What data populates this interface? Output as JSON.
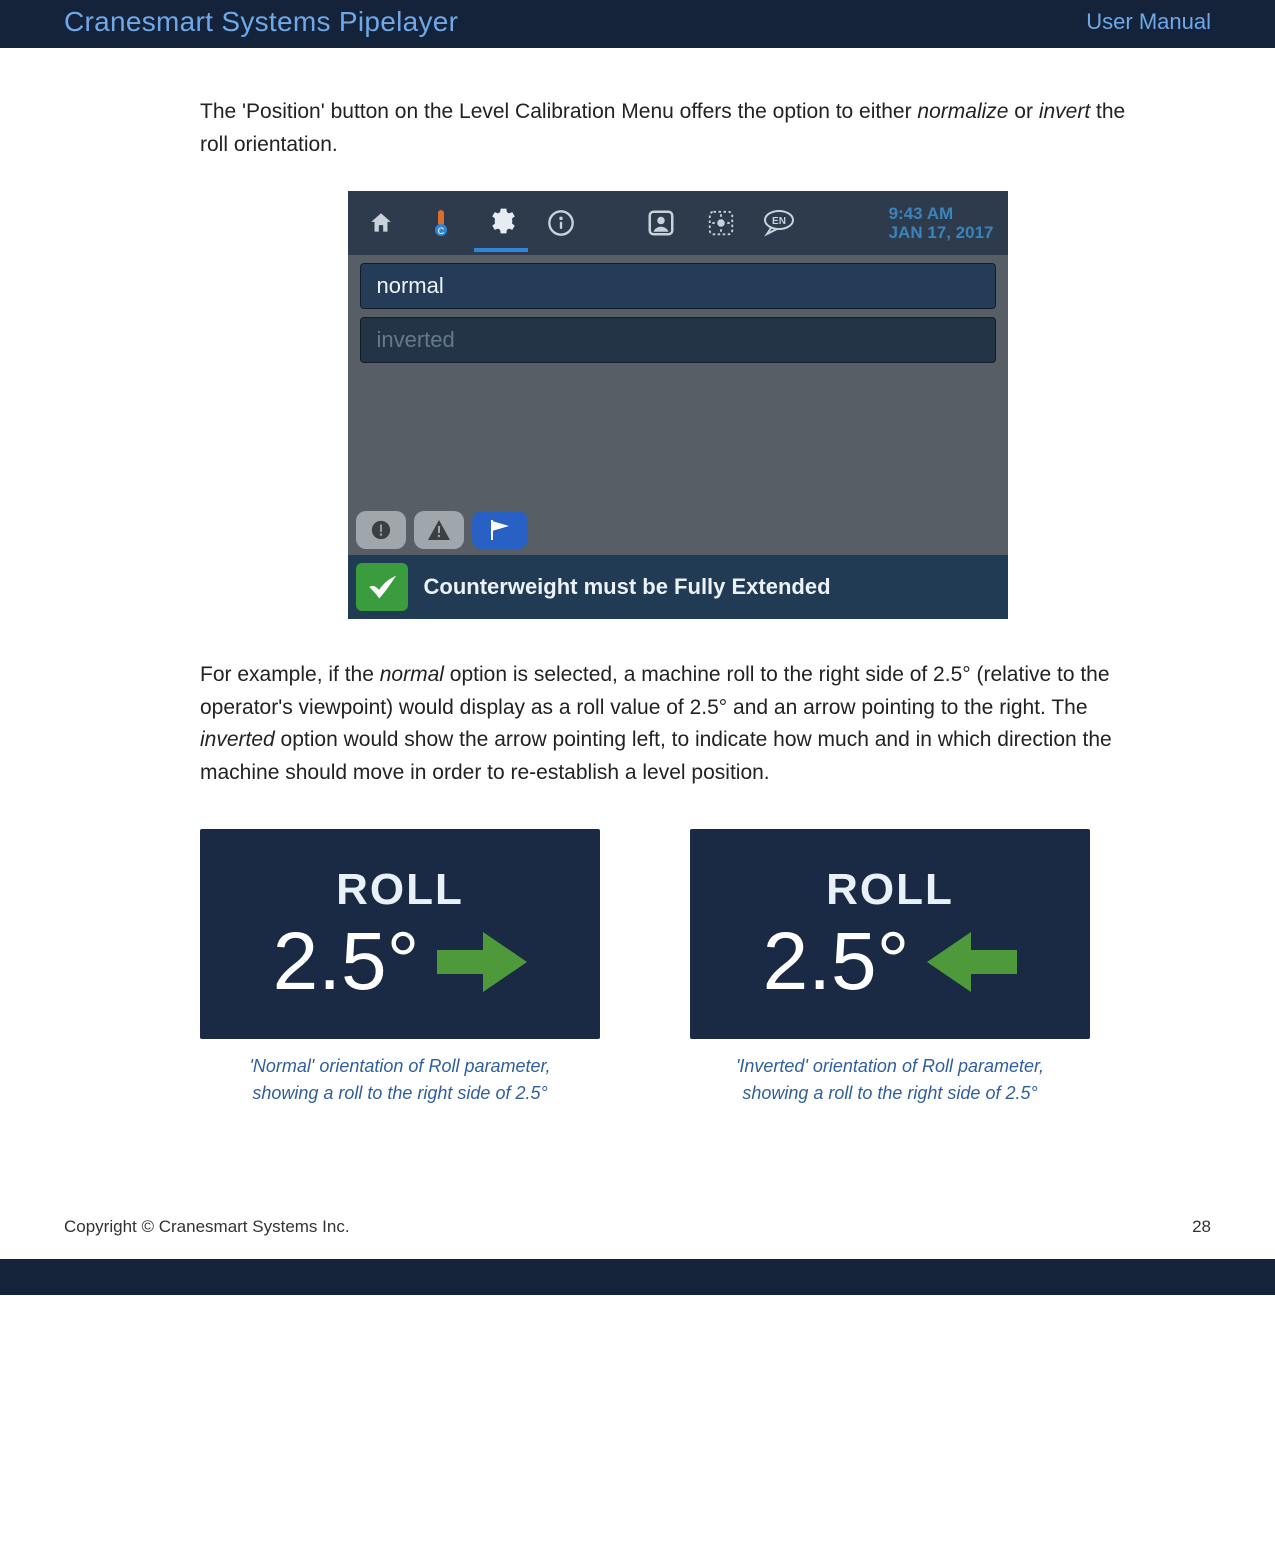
{
  "header": {
    "title": "Cranesmart Systems Pipelayer",
    "subtitle": "User Manual"
  },
  "body": {
    "para1_pre": "The 'Position' button on the Level Calibration Menu offers the option to either ",
    "para1_em1": "normalize",
    "para1_mid": " or ",
    "para1_em2": "invert",
    "para1_post": " the roll orientation.",
    "para2_a": "For example, if the ",
    "para2_em1": "normal",
    "para2_b": " option is selected, a machine roll to the right side of 2.5° (relative to the operator's viewpoint) would display as a roll value of 2.5° and an arrow pointing to the right.  The ",
    "para2_em2": "inverted",
    "para2_c": " option would show the arrow pointing left, to indicate how much and in which direction the machine should move in order to re-establish a level position."
  },
  "device": {
    "time": "9:43 AM",
    "date": "JAN 17, 2017",
    "lang": "EN",
    "options": {
      "selected": "normal",
      "other": "inverted"
    },
    "status_message": "Counterweight must be Fully Extended"
  },
  "roll": {
    "label": "ROLL",
    "value": "2.5°",
    "caption_normal_a": "'Normal' orientation of Roll parameter,",
    "caption_normal_b": "showing a roll to the right side of 2.5°",
    "caption_inverted_a": "'Inverted' orientation of Roll parameter,",
    "caption_inverted_b": "showing a roll to the right side of 2.5°"
  },
  "footer": {
    "copyright": "Copyright © Cranesmart Systems Inc.",
    "page": "28"
  }
}
